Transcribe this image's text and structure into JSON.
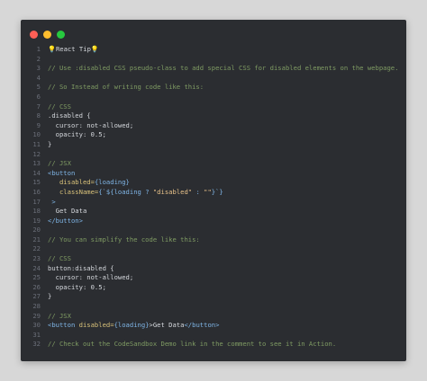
{
  "window": {
    "colors": {
      "background": "#2b2d31",
      "close": "#ff5f56",
      "minimize": "#ffbd2e",
      "maximize": "#27c93f"
    }
  },
  "code_lines": [
    {
      "n": "1",
      "segments": [
        {
          "t": "💡React Tip💡",
          "c": "c-plain"
        }
      ]
    },
    {
      "n": "2",
      "segments": []
    },
    {
      "n": "3",
      "segments": [
        {
          "t": "// Use :disabled CSS pseudo-class to add special CSS for disabled elements on the webpage.",
          "c": "c-comment"
        }
      ]
    },
    {
      "n": "4",
      "segments": []
    },
    {
      "n": "5",
      "segments": [
        {
          "t": "// So Instead of writing code like this:",
          "c": "c-comment"
        }
      ]
    },
    {
      "n": "6",
      "segments": []
    },
    {
      "n": "7",
      "segments": [
        {
          "t": "// CSS",
          "c": "c-comment"
        }
      ]
    },
    {
      "n": "8",
      "segments": [
        {
          "t": ".disabled {",
          "c": "c-sel"
        }
      ]
    },
    {
      "n": "9",
      "segments": [
        {
          "t": "  cursor: not-allowed;",
          "c": "c-plain"
        }
      ]
    },
    {
      "n": "10",
      "segments": [
        {
          "t": "  opacity: 0.5;",
          "c": "c-plain"
        }
      ]
    },
    {
      "n": "11",
      "segments": [
        {
          "t": "}",
          "c": "c-plain"
        }
      ]
    },
    {
      "n": "12",
      "segments": []
    },
    {
      "n": "13",
      "segments": [
        {
          "t": "// JSX",
          "c": "c-comment"
        }
      ]
    },
    {
      "n": "14",
      "segments": [
        {
          "t": "<button",
          "c": "c-tag"
        }
      ]
    },
    {
      "n": "15",
      "segments": [
        {
          "t": "   disabled=",
          "c": "c-attr"
        },
        {
          "t": "{loading}",
          "c": "c-tag"
        }
      ]
    },
    {
      "n": "16",
      "segments": [
        {
          "t": "   className=",
          "c": "c-attr"
        },
        {
          "t": "{`${loading ? ",
          "c": "c-tag"
        },
        {
          "t": "\"disabled\"",
          "c": "c-str"
        },
        {
          "t": " : ",
          "c": "c-tag"
        },
        {
          "t": "\"\"",
          "c": "c-str"
        },
        {
          "t": "}`}",
          "c": "c-tag"
        }
      ]
    },
    {
      "n": "17",
      "segments": [
        {
          "t": " >",
          "c": "c-tag"
        }
      ]
    },
    {
      "n": "18",
      "segments": [
        {
          "t": "  Get Data",
          "c": "c-plain"
        }
      ]
    },
    {
      "n": "19",
      "segments": [
        {
          "t": "</button>",
          "c": "c-tag"
        }
      ]
    },
    {
      "n": "20",
      "segments": []
    },
    {
      "n": "21",
      "segments": [
        {
          "t": "// You can simplify the code like this:",
          "c": "c-comment"
        }
      ]
    },
    {
      "n": "22",
      "segments": []
    },
    {
      "n": "23",
      "segments": [
        {
          "t": "// CSS",
          "c": "c-comment"
        }
      ]
    },
    {
      "n": "24",
      "segments": [
        {
          "t": "button:disabled {",
          "c": "c-sel"
        }
      ]
    },
    {
      "n": "25",
      "segments": [
        {
          "t": "  cursor: not-allowed;",
          "c": "c-plain"
        }
      ]
    },
    {
      "n": "26",
      "segments": [
        {
          "t": "  opacity: 0.5;",
          "c": "c-plain"
        }
      ]
    },
    {
      "n": "27",
      "segments": [
        {
          "t": "}",
          "c": "c-plain"
        }
      ]
    },
    {
      "n": "28",
      "segments": []
    },
    {
      "n": "29",
      "segments": [
        {
          "t": "// JSX",
          "c": "c-comment"
        }
      ]
    },
    {
      "n": "30",
      "segments": [
        {
          "t": "<button ",
          "c": "c-tag"
        },
        {
          "t": "disabled=",
          "c": "c-attr"
        },
        {
          "t": "{loading}",
          "c": "c-tag"
        },
        {
          "t": ">Get Data",
          "c": "c-plain"
        },
        {
          "t": "</button>",
          "c": "c-tag"
        }
      ]
    },
    {
      "n": "31",
      "segments": []
    },
    {
      "n": "32",
      "segments": [
        {
          "t": "// Check out the CodeSandbox Demo link in the comment to see it in Action.",
          "c": "c-comment"
        }
      ]
    }
  ]
}
